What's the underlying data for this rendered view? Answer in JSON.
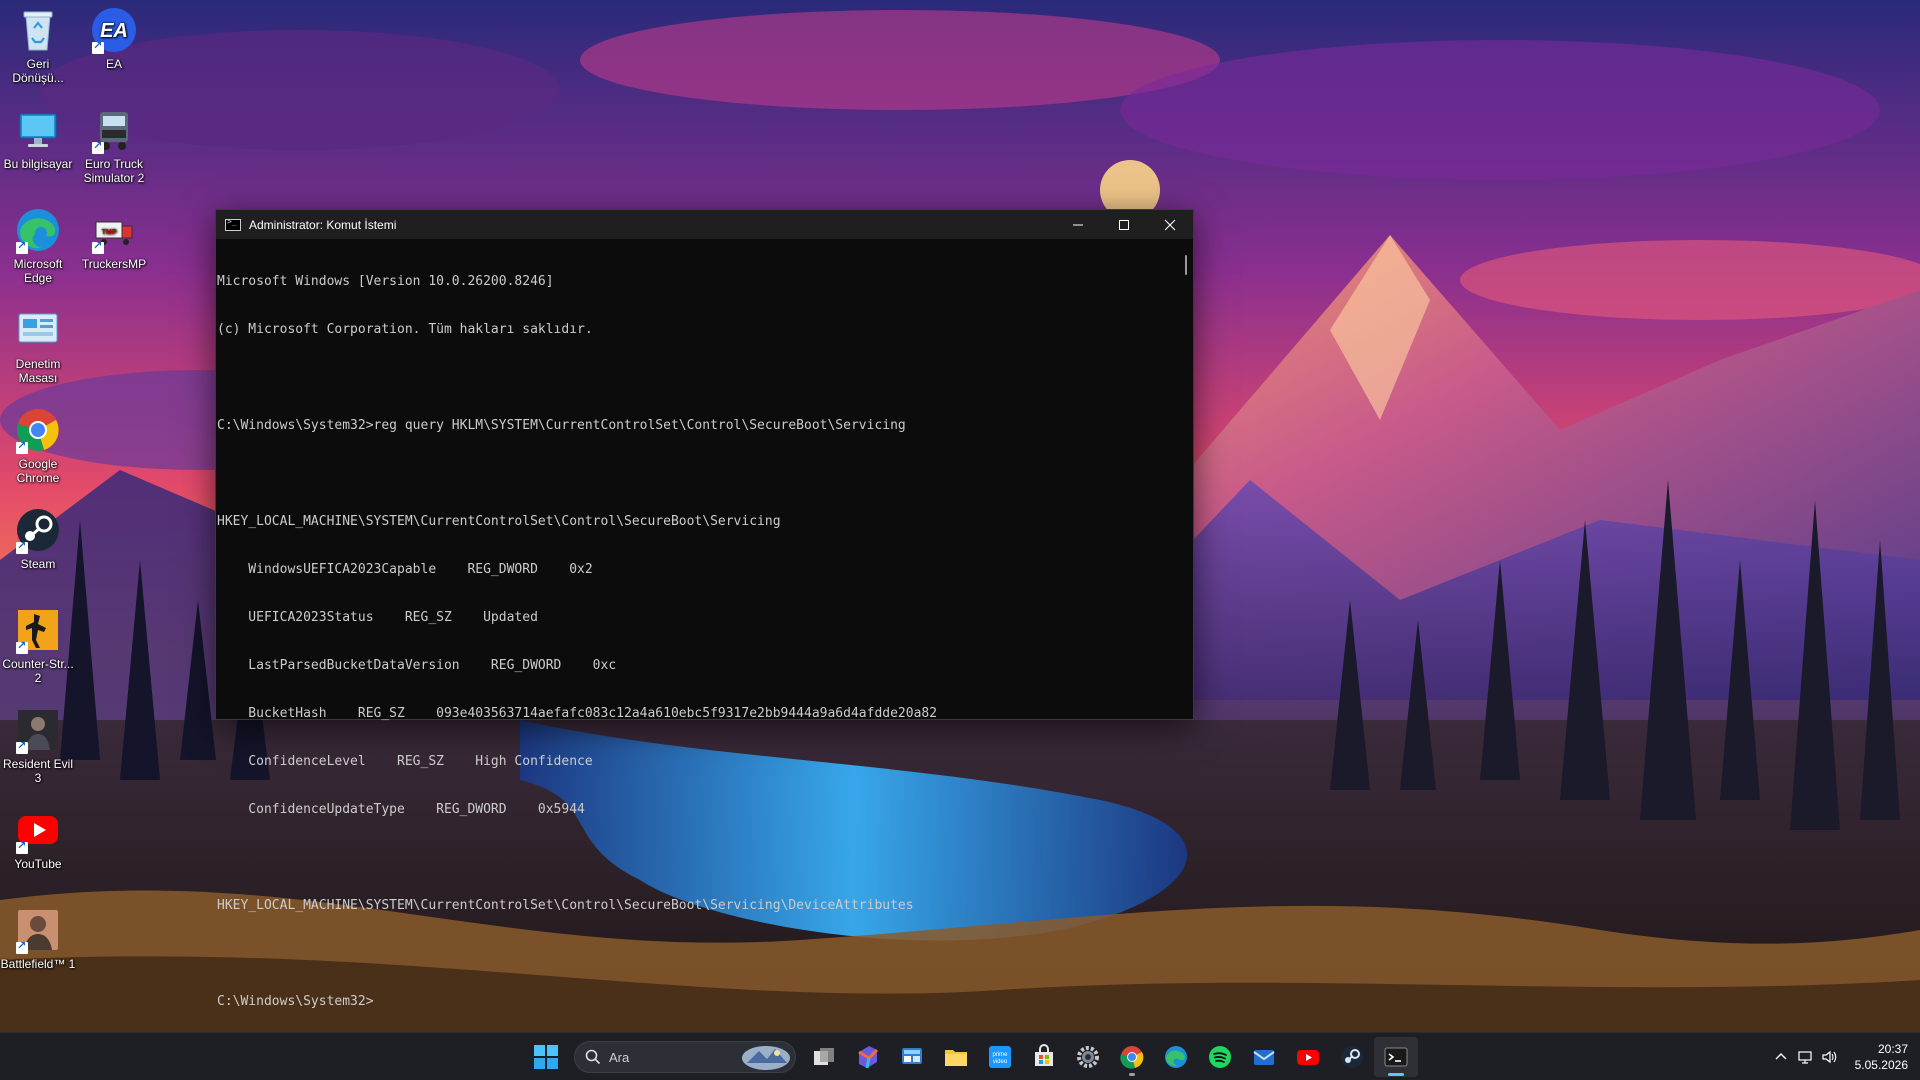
{
  "desktop_icons": [
    {
      "label": "Geri Dönüşü...",
      "icon": "recycle-bin-icon"
    },
    {
      "label": "EA",
      "icon": "ea-icon"
    },
    {
      "label": "Bu bilgisayar",
      "icon": "this-pc-icon"
    },
    {
      "label": "Euro Truck Simulator 2",
      "icon": "euro-truck-simulator-icon"
    },
    {
      "label": "Microsoft Edge",
      "icon": "edge-icon"
    },
    {
      "label": "TruckersMP",
      "icon": "truckersmp-icon"
    },
    {
      "label": "Denetim Masası",
      "icon": "control-panel-icon"
    },
    {
      "label": "Google Chrome",
      "icon": "chrome-icon"
    },
    {
      "label": "Steam",
      "icon": "steam-icon"
    },
    {
      "label": "Counter-Str... 2",
      "icon": "counter-strike-icon"
    },
    {
      "label": "Resident Evil 3",
      "icon": "resident-evil-icon"
    },
    {
      "label": "YouTube",
      "icon": "youtube-icon"
    },
    {
      "label": "Battlefield™ 1",
      "icon": "battlefield-icon"
    }
  ],
  "cmd_window": {
    "title": "Administrator: Komut İstemi",
    "lines": [
      "Microsoft Windows [Version 10.0.26200.8246]",
      "(c) Microsoft Corporation. Tüm hakları saklıdır.",
      "",
      "C:\\Windows\\System32>reg query HKLM\\SYSTEM\\CurrentControlSet\\Control\\SecureBoot\\Servicing",
      "",
      "HKEY_LOCAL_MACHINE\\SYSTEM\\CurrentControlSet\\Control\\SecureBoot\\Servicing",
      "    WindowsUEFICA2023Capable    REG_DWORD    0x2",
      "    UEFICA2023Status    REG_SZ    Updated",
      "    LastParsedBucketDataVersion    REG_DWORD    0xc",
      "    BucketHash    REG_SZ    093e403563714aefafc083c12a4a610ebc5f9317e2bb9444a9a6d4afdde20a82",
      "    ConfidenceLevel    REG_SZ    High Confidence",
      "    ConfidenceUpdateType    REG_DWORD    0x5944",
      "",
      "HKEY_LOCAL_MACHINE\\SYSTEM\\CurrentControlSet\\Control\\SecureBoot\\Servicing\\DeviceAttributes",
      "",
      "C:\\Windows\\System32>"
    ]
  },
  "taskbar": {
    "search_placeholder": "Ara",
    "apps": [
      {
        "name": "task-view-icon"
      },
      {
        "name": "microsoft-365-icon"
      },
      {
        "name": "widgets-icon"
      },
      {
        "name": "file-explorer-icon"
      },
      {
        "name": "prime-video-icon"
      },
      {
        "name": "microsoft-store-icon"
      },
      {
        "name": "settings-gear-icon"
      },
      {
        "name": "chrome-icon",
        "running": true
      },
      {
        "name": "edge-icon"
      },
      {
        "name": "spotify-icon"
      },
      {
        "name": "mail-icon"
      },
      {
        "name": "youtube-icon"
      },
      {
        "name": "steam-icon"
      },
      {
        "name": "terminal-icon",
        "active": true
      }
    ],
    "time": "20:37",
    "date": "5.05.2026"
  },
  "colors": {
    "cmd_text": "#cccccc",
    "cmd_bg": "#0c0c0c",
    "taskbar_bg": "#1c1e24",
    "active_indicator": "#5cc9f5"
  }
}
